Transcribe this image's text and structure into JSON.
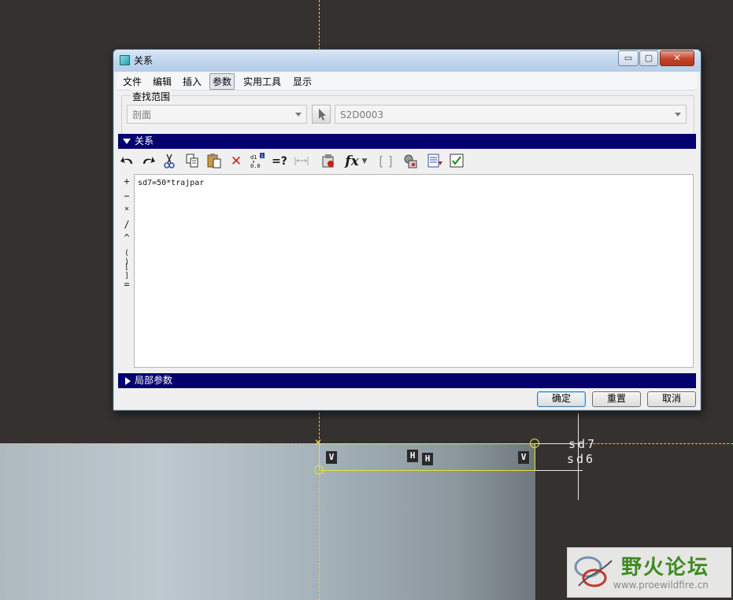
{
  "window": {
    "title": "关系",
    "controls": {
      "minimize": "▭",
      "maximize": "▢",
      "close": "✕"
    }
  },
  "menubar": {
    "items": [
      "文件",
      "编辑",
      "插入",
      "参数",
      "实用工具",
      "显示"
    ],
    "active": "参数"
  },
  "search": {
    "label": "查找范围",
    "scope_value": "剖面",
    "object_value": "S2D0003"
  },
  "relations": {
    "section_title": "关系",
    "operators": [
      "+",
      "−",
      "×",
      "/",
      "^",
      "( )",
      "[ ]",
      "="
    ],
    "text": "sd7=50*trajpar"
  },
  "local_params": {
    "section_title": "局部参数"
  },
  "buttons": {
    "ok": "确定",
    "reset": "重置",
    "cancel": "取消"
  },
  "sketch": {
    "constraints": [
      "V",
      "H",
      "H",
      "V"
    ],
    "dims": [
      "sd7",
      "sd6"
    ]
  },
  "watermark": {
    "title": "野火论坛",
    "url": "www.proewildfire.cn"
  },
  "colors": {
    "section_bar": "#05006e",
    "sketch_line": "#e6e03a",
    "background": "#34312e"
  }
}
